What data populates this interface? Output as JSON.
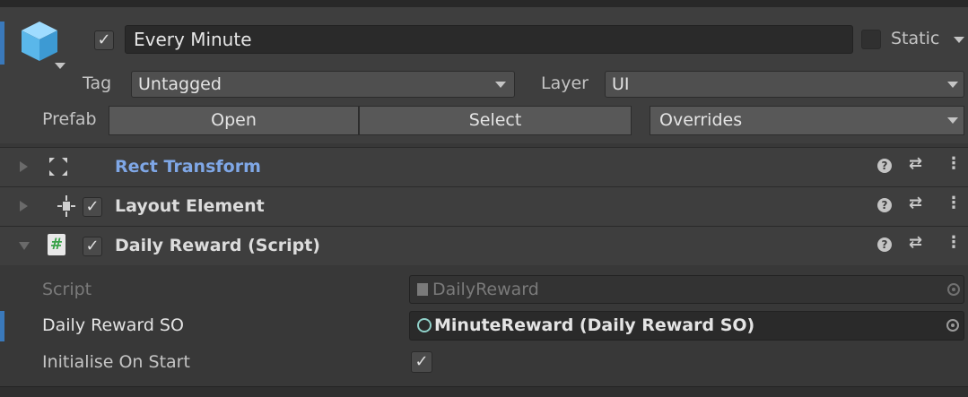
{
  "header": {
    "active": true,
    "name": "Every Minute",
    "static_label": "Static",
    "static_checked": false,
    "tag_label": "Tag",
    "tag_value": "Untagged",
    "layer_label": "Layer",
    "layer_value": "UI",
    "prefab_label": "Prefab",
    "prefab_buttons": [
      "Open",
      "Select",
      "Overrides"
    ]
  },
  "components": [
    {
      "title": "Rect Transform",
      "icon": "rect-transform-icon",
      "expanded": false,
      "has_toggle": false,
      "color": "#7fa7e6"
    },
    {
      "title": "Layout Element",
      "icon": "layout-element-icon",
      "expanded": false,
      "has_toggle": true,
      "enabled": true
    },
    {
      "title": "Daily Reward (Script)",
      "icon": "csharp-script-icon",
      "expanded": true,
      "has_toggle": true,
      "enabled": true
    }
  ],
  "script_fields": {
    "script_label": "Script",
    "script_value": "DailyReward",
    "so_label": "Daily Reward SO",
    "so_value": "MinuteReward (Daily Reward SO)",
    "init_label": "Initialise On Start",
    "init_checked": true
  },
  "component_actions": [
    "help-icon",
    "presets-icon",
    "context-menu-icon"
  ],
  "colors": {
    "accent_blue": "#3a79bb",
    "panel": "#3e3e3e",
    "field": "#2a2a2a"
  }
}
